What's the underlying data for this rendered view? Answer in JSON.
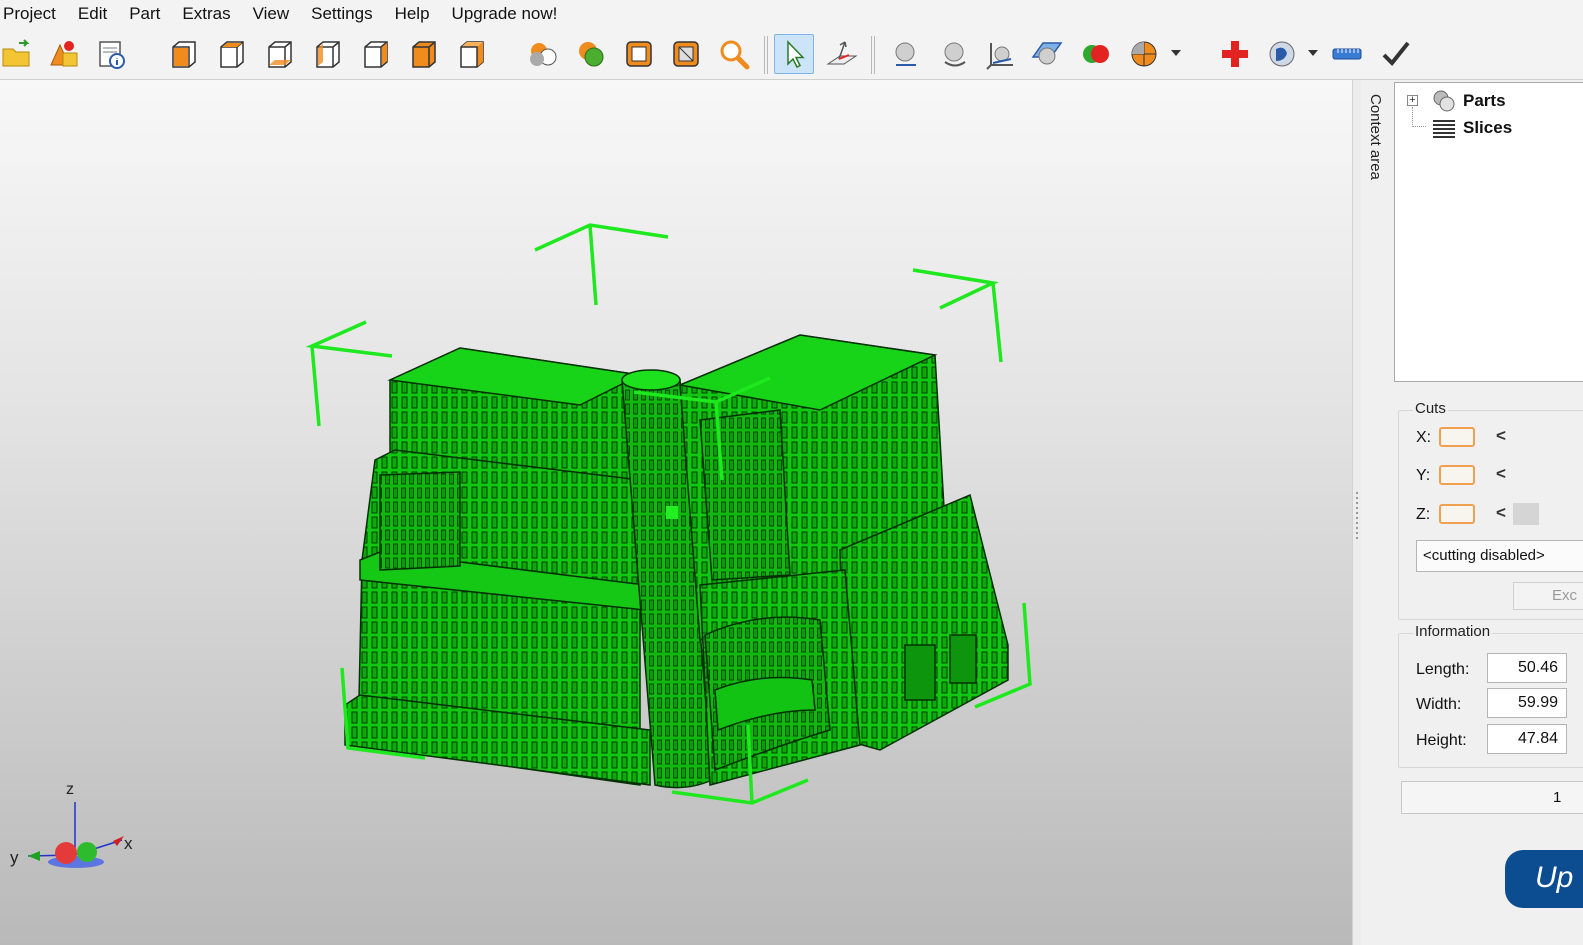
{
  "menu": [
    "Project",
    "Edit",
    "Part",
    "Extras",
    "View",
    "Settings",
    "Help",
    "Upgrade now!"
  ],
  "toolbar": {
    "groups": [
      [
        "open-project-icon",
        "add-part-icon",
        "project-info-icon"
      ],
      [
        "view-front-icon",
        "view-back-icon",
        "view-left-icon",
        "view-right-icon",
        "view-top-icon",
        "view-bottom-icon",
        "view-iso-icon"
      ],
      [
        "render-shaded-icon",
        "render-smooth-icon",
        "render-wireframe-icon",
        "render-edges-icon",
        "zoom-fit-icon"
      ],
      [
        "select-arrow-icon",
        "select-plane-icon"
      ],
      [
        "sphere-icon",
        "rotate-icon",
        "axis-transform-icon",
        "plane-view-icon",
        "color-parts-icon",
        "section-view-icon",
        "repair-cross-icon",
        "measure-icon",
        "ruler-icon",
        "checkmark-icon"
      ]
    ],
    "active": "select-arrow-icon",
    "colors": {
      "orange": "#f08c1e",
      "blue": "#3a7bd5",
      "red": "#e32222",
      "green": "#2ea82e"
    }
  },
  "viewport": {
    "model_color": "#11c811",
    "axes": {
      "x": "x",
      "y": "y",
      "z": "z"
    }
  },
  "side_tab": "Context area",
  "tree": {
    "items": [
      {
        "label": "Parts",
        "icon": "parts-icon"
      },
      {
        "label": "Slices",
        "icon": "slices-icon"
      }
    ]
  },
  "cuts": {
    "title": "Cuts",
    "rows": [
      {
        "axis": "X:"
      },
      {
        "axis": "Y:"
      },
      {
        "axis": "Z:"
      }
    ],
    "arrow": "<",
    "mode": "<cutting disabled>",
    "export_label": "Exc"
  },
  "information": {
    "title": "Information",
    "length_label": "Length:",
    "length": "50.46",
    "width_label": "Width:",
    "width": "59.99",
    "height_label": "Height:",
    "height": "47.84"
  },
  "slider_value": "1",
  "upgrade_label": "Up"
}
